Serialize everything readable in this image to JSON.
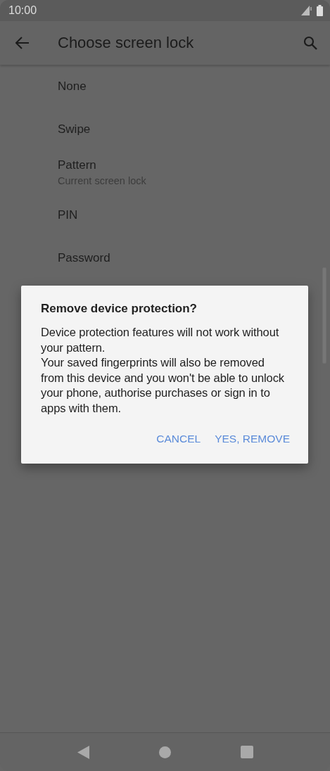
{
  "status_bar": {
    "time": "10:00"
  },
  "app_bar": {
    "title": "Choose screen lock"
  },
  "options": [
    {
      "title": "None"
    },
    {
      "title": "Swipe"
    },
    {
      "title": "Pattern",
      "subtitle": "Current screen lock"
    },
    {
      "title": "PIN"
    },
    {
      "title": "Password"
    }
  ],
  "dialog": {
    "title": "Remove device protection?",
    "paragraphs": [
      "Device protection features will not work without your pattern.",
      "Your saved fingerprints will also be removed from this device and you won't be able to unlock your phone, authorise purchases or sign in to apps with them."
    ],
    "buttons": [
      "CANCEL",
      "YES, REMOVE"
    ]
  }
}
